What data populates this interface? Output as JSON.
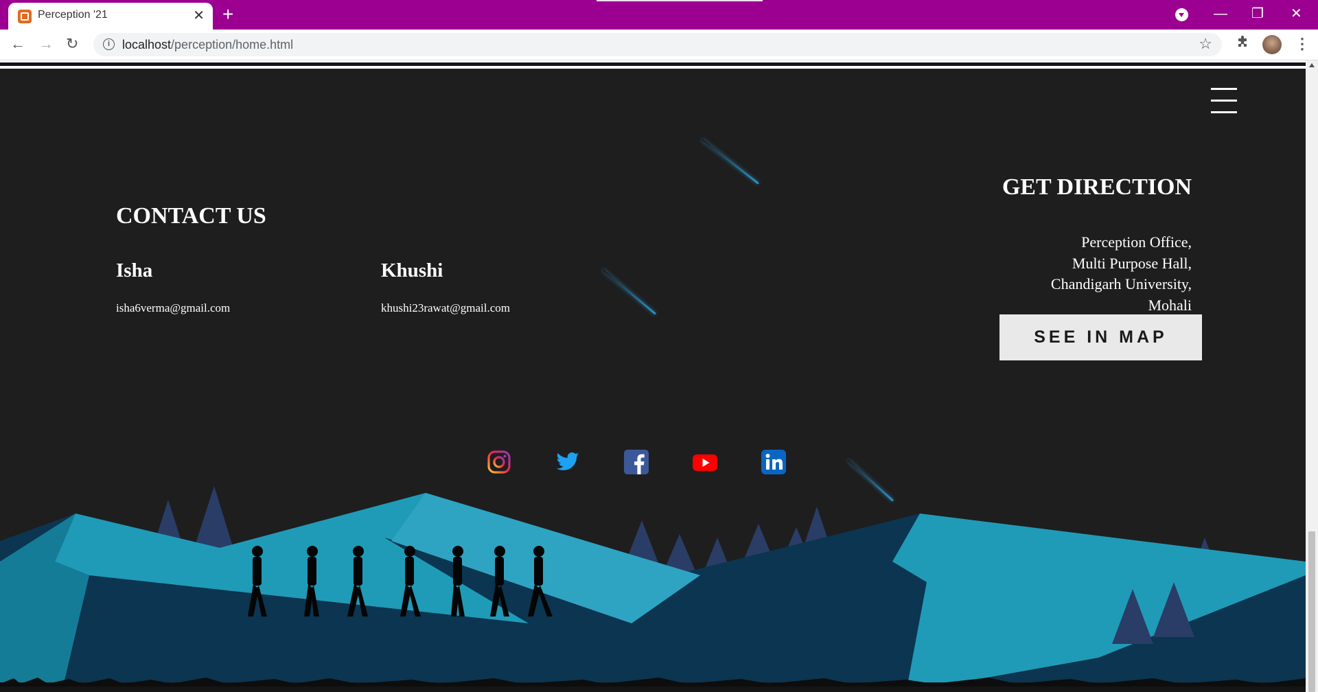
{
  "browser": {
    "tab_title": "Perception '21",
    "tab_close": "✕",
    "new_tab": "+",
    "url_host": "localhost",
    "url_path": "/perception/home.html",
    "window_controls": {
      "minimize": "—",
      "restore": "❐",
      "close": "✕"
    },
    "accent_color": "#9b0090"
  },
  "contact": {
    "title": "CONTACT US",
    "people": [
      {
        "name": "Isha",
        "email": "isha6verma@gmail.com"
      },
      {
        "name": "Khushi",
        "email": "khushi23rawat@gmail.com"
      }
    ]
  },
  "direction": {
    "title": "GET DIRECTION",
    "address_lines": [
      "Perception Office,",
      "Multi Purpose Hall,",
      "Chandigarh University,",
      "Mohali"
    ],
    "map_button": "SEE IN MAP"
  },
  "socials": [
    "instagram-icon",
    "twitter-icon",
    "facebook-icon",
    "youtube-icon",
    "linkedin-icon"
  ],
  "colors": {
    "background": "#1e1e1e",
    "mountain_light": "#1f9bb8",
    "mountain_dark": "#0b3550",
    "trees": "#2a3d66"
  }
}
